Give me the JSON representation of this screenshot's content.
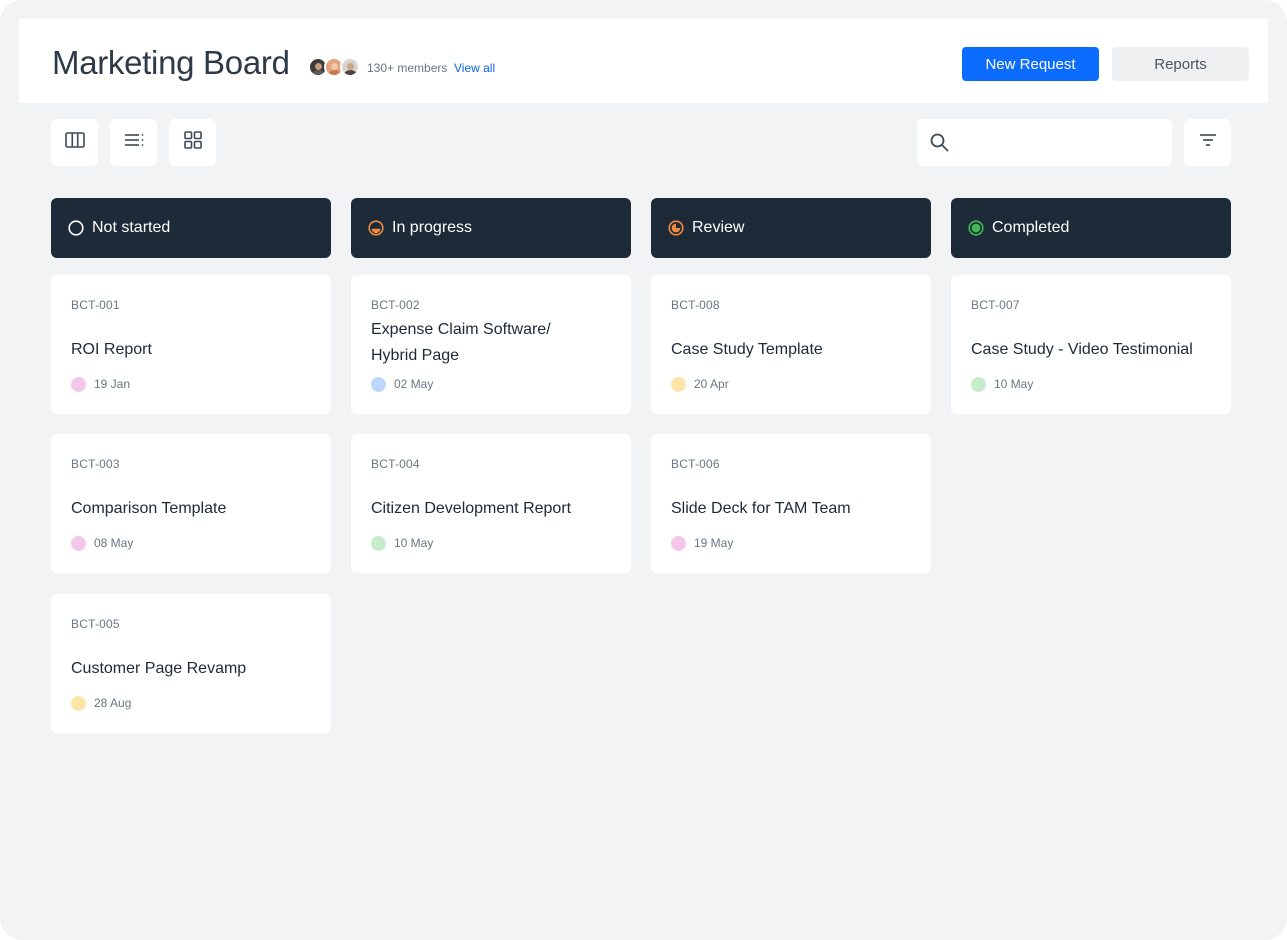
{
  "header": {
    "title": "Marketing Board",
    "members_text": "130+ members",
    "view_all": "View all",
    "new_request": "New Request",
    "reports": "Reports"
  },
  "toolbar": {
    "views": [
      "columns-view-icon",
      "list-view-icon",
      "grid-view-icon"
    ],
    "search_placeholder": "",
    "filter_icon": "filter-icon"
  },
  "colors": {
    "accent": "#0b6cff",
    "column_header_bg": "#1d2a37",
    "in_progress": "#f0883e",
    "completed": "#3fb950",
    "dot_pink": "#f5c6ec",
    "dot_blue": "#bcd7fb",
    "dot_yellow": "#fde4a8",
    "dot_green": "#c6eccb"
  },
  "columns": [
    {
      "label": "Not started",
      "status_icon": "empty-circle-icon",
      "cards": [
        {
          "id": "BCT-001",
          "title": "ROI Report",
          "date": "19 Jan",
          "dot": "#f5c6ec"
        },
        {
          "id": "BCT-003",
          "title": "Comparison Template",
          "date": "08 May",
          "dot": "#f5c6ec"
        },
        {
          "id": "BCT-005",
          "title": "Customer Page Revamp",
          "date": "28 Aug",
          "dot": "#fde4a8"
        }
      ]
    },
    {
      "label": "In progress",
      "status_icon": "half-circle-icon",
      "cards": [
        {
          "id": "BCT-002",
          "title": "Expense Claim Software/ Hybrid Page",
          "date": "02 May",
          "dot": "#bcd7fb"
        },
        {
          "id": "BCT-004",
          "title": "Citizen Development Report",
          "date": "10 May",
          "dot": "#c6eccb"
        }
      ]
    },
    {
      "label": "Review",
      "status_icon": "three-quarter-circle-icon",
      "cards": [
        {
          "id": "BCT-008",
          "title": "Case Study Template",
          "date": "20 Apr",
          "dot": "#fde4a8"
        },
        {
          "id": "BCT-006",
          "title": "Slide Deck for TAM Team",
          "date": "19 May",
          "dot": "#f5c6ec"
        }
      ]
    },
    {
      "label": "Completed",
      "status_icon": "filled-circle-icon",
      "cards": [
        {
          "id": "BCT-007",
          "title": "Case Study - Video Testimonial",
          "date": "10 May",
          "dot": "#c6eccb"
        }
      ]
    }
  ]
}
